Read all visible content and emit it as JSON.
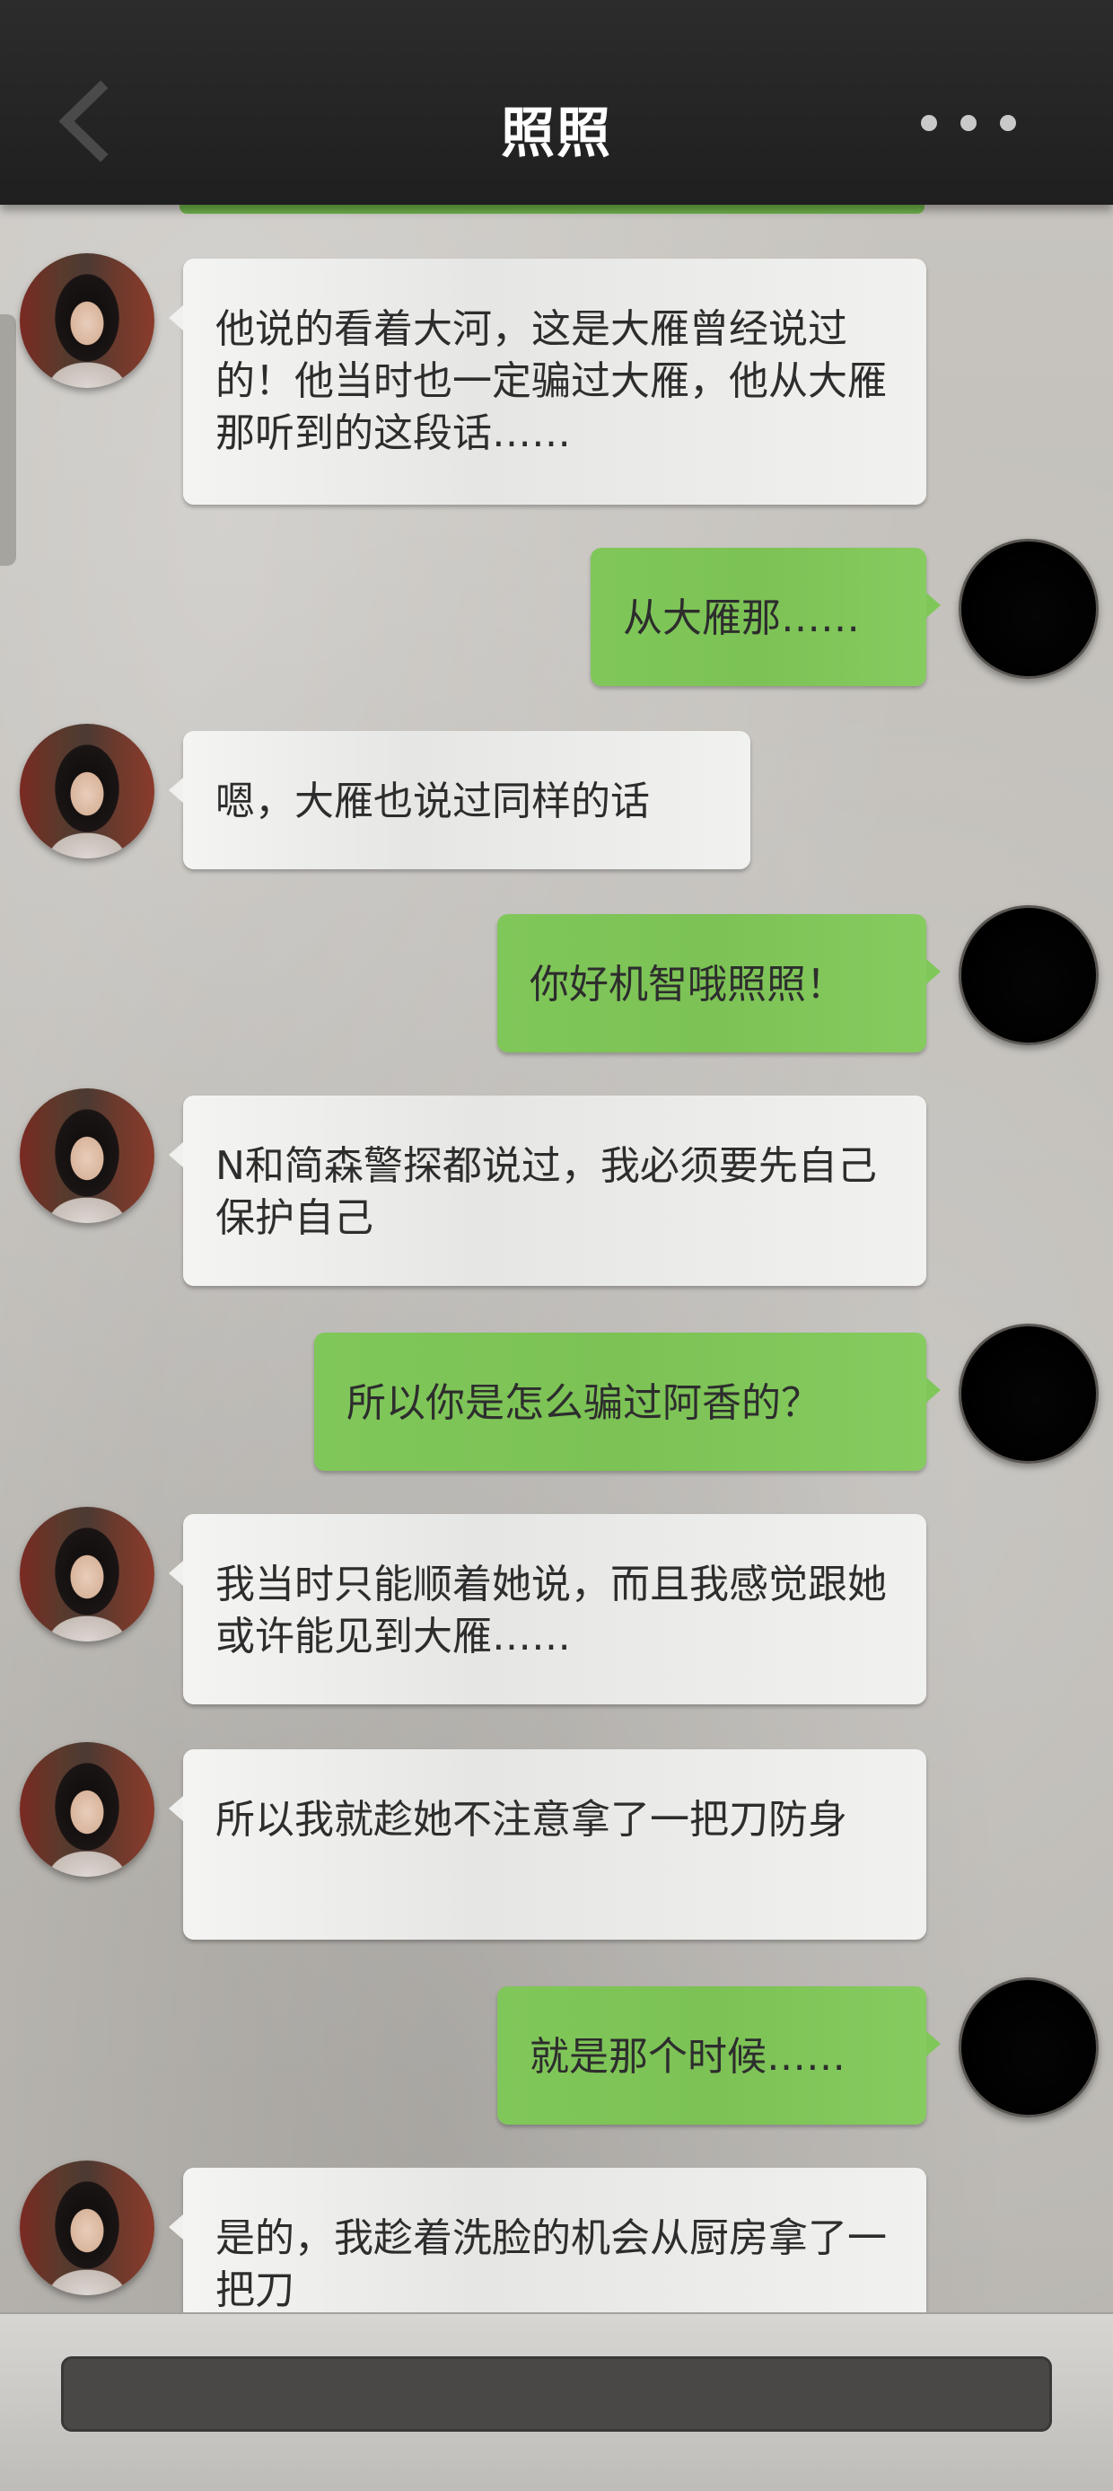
{
  "header": {
    "title": "照照"
  },
  "messages": [
    {
      "side": "left",
      "text": "他说的看着大河，这是大雁曾经说过的！他当时也一定骗过大雁，他从大雁那听到的这段话……"
    },
    {
      "side": "right",
      "text": "从大雁那……"
    },
    {
      "side": "left",
      "text": "嗯，大雁也说过同样的话"
    },
    {
      "side": "right",
      "text": "你好机智哦照照！"
    },
    {
      "side": "left",
      "text": "N和简森警探都说过，我必须要先自己保护自己"
    },
    {
      "side": "right",
      "text": "所以你是怎么骗过阿香的？"
    },
    {
      "side": "left",
      "text": "我当时只能顺着她说，而且我感觉跟她或许能见到大雁……"
    },
    {
      "side": "left",
      "text": "所以我就趁她不注意拿了一把刀防身"
    },
    {
      "side": "right",
      "text": "就是那个时候……"
    },
    {
      "side": "left",
      "text": "是的，我趁着洗脸的机会从厨房拿了一把刀"
    }
  ],
  "icons": {
    "back": "chevron-left-icon",
    "more": "more-dots-icon"
  },
  "colors": {
    "header_bg": "#222222",
    "left_bubble": "#eeeeec",
    "right_bubble": "#7cc255",
    "input_bg": "#4a4846"
  }
}
